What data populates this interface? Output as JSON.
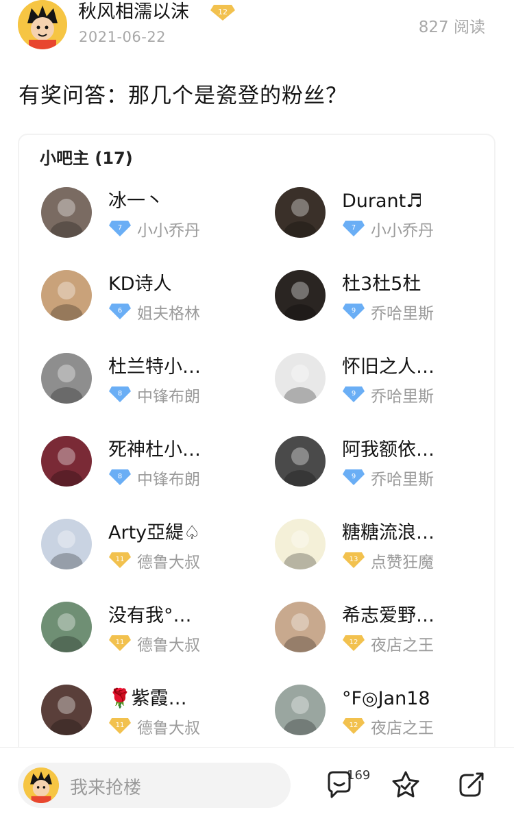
{
  "post": {
    "author": "秋风相濡以沫",
    "author_level": "12",
    "date": "2021-06-22",
    "reads": "827 阅读",
    "title": "有奖问答：那几个是瓷登的粉丝？"
  },
  "card": {
    "title": "小吧主 (17)",
    "members": [
      {
        "name": "冰一丶",
        "level": "7",
        "rank": "小小乔丹",
        "badge_color": "#6aaef5"
      },
      {
        "name": "Durant♬",
        "level": "7",
        "rank": "小小乔丹",
        "badge_color": "#6aaef5"
      },
      {
        "name": "KD诗人",
        "level": "6",
        "rank": "姐夫格林",
        "badge_color": "#6aaef5"
      },
      {
        "name": "杜3杜5杜",
        "level": "9",
        "rank": "乔哈里斯",
        "badge_color": "#6aaef5"
      },
      {
        "name": "杜兰特小…",
        "level": "8",
        "rank": "中锋布朗",
        "badge_color": "#6aaef5"
      },
      {
        "name": "怀旧之人…",
        "level": "9",
        "rank": "乔哈里斯",
        "badge_color": "#6aaef5"
      },
      {
        "name": "死神杜小…",
        "level": "8",
        "rank": "中锋布朗",
        "badge_color": "#6aaef5"
      },
      {
        "name": "阿我额依…",
        "level": "9",
        "rank": "乔哈里斯",
        "badge_color": "#6aaef5"
      },
      {
        "name": "Arty亞緹♤",
        "level": "11",
        "rank": "德鲁大叔",
        "badge_color": "#f2c14e"
      },
      {
        "name": "糖糖流浪…",
        "level": "13",
        "rank": "点赞狂魔",
        "badge_color": "#f2c14e"
      },
      {
        "name": "没有我°…",
        "level": "11",
        "rank": "德鲁大叔",
        "badge_color": "#f2c14e"
      },
      {
        "name": "希志爱野…",
        "level": "12",
        "rank": "夜店之王",
        "badge_color": "#f2c14e"
      },
      {
        "name": "🌹紫霞…",
        "level": "11",
        "rank": "德鲁大叔",
        "badge_color": "#f2c14e"
      },
      {
        "name": "°F◎Jan18",
        "level": "12",
        "rank": "夜店之王",
        "badge_color": "#f2c14e"
      }
    ],
    "avatar_tones": [
      "#7a6b62",
      "#3a3029",
      "#c9a27a",
      "#2a2522",
      "#8e8e8e",
      "#e8e8e8",
      "#7a2a36",
      "#4a4a4a",
      "#c9d3e2",
      "#f4f0d8",
      "#6f8f74",
      "#c8a98e",
      "#5a3f3a",
      "#9aa6a0"
    ]
  },
  "bottom": {
    "placeholder": "我来抢楼",
    "comment_count": "169"
  },
  "colors": {
    "accent_gold": "#f2c14e",
    "accent_blue": "#6aaef5",
    "muted_text": "#9b9b9b"
  }
}
